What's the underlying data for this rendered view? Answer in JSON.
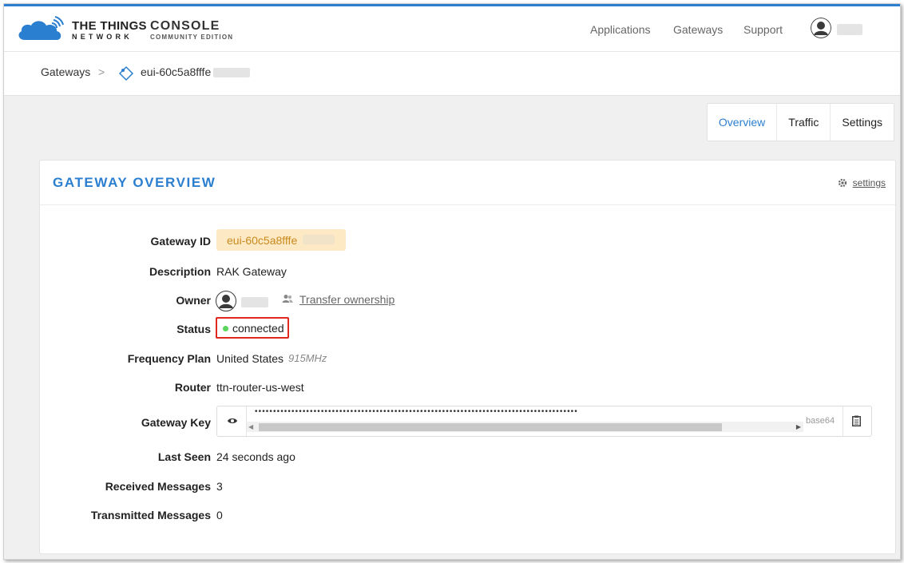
{
  "header": {
    "brand_line1": "THE THINGS",
    "brand_line2": "NETWORK",
    "console_line1": "CONSOLE",
    "console_line2": "COMMUNITY EDITION",
    "nav": [
      "Applications",
      "Gateways",
      "Support"
    ],
    "accent_color": "#2b7fd0"
  },
  "breadcrumb": {
    "items": [
      "Gateways",
      "eui-60c5a8fffe"
    ],
    "separator": ">",
    "icon": "gateway-tag-icon"
  },
  "tabs": [
    "Overview",
    "Traffic",
    "Settings"
  ],
  "card": {
    "title": "GATEWAY OVERVIEW",
    "settings_label": "settings",
    "rows": {
      "gateway_id": {
        "label": "Gateway ID",
        "value": "eui-60c5a8fffe"
      },
      "description": {
        "label": "Description",
        "value": "RAK Gateway"
      },
      "owner": {
        "label": "Owner",
        "transfer_label": "Transfer ownership"
      },
      "status": {
        "label": "Status",
        "value": "connected",
        "color": "#5ad65a"
      },
      "frequency_plan": {
        "label": "Frequency Plan",
        "value": "United States",
        "detail": "915MHz"
      },
      "router": {
        "label": "Router",
        "value": "ttn-router-us-west"
      },
      "gateway_key": {
        "label": "Gateway Key",
        "masked": "••••••••••••••••••••••••••••••••••••••••••••••••••••••••••••••••••••••••••••••••••••••••",
        "encoding": "base64"
      },
      "last_seen": {
        "label": "Last Seen",
        "value": "24 seconds ago"
      },
      "received": {
        "label": "Received Messages",
        "value": "3"
      },
      "transmitted": {
        "label": "Transmitted Messages",
        "value": "0"
      }
    }
  }
}
